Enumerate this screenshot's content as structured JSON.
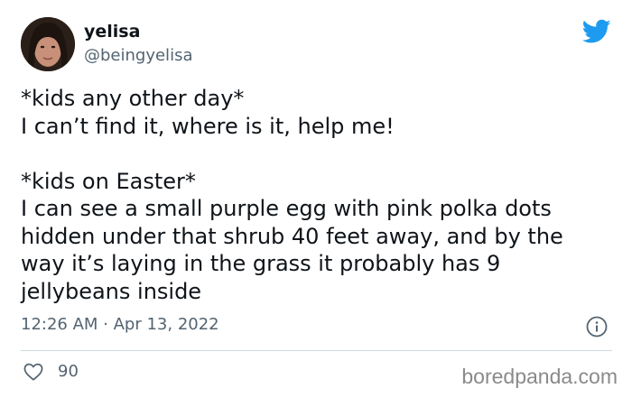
{
  "author": {
    "display_name": "yelisa",
    "handle": "@beingyelisa"
  },
  "tweet": {
    "lines_block1": [
      "*kids any other day*",
      "I can’t find it, where is it, help me!"
    ],
    "lines_block2": [
      "*kids on Easter*",
      "I can see a small purple egg with pink polka dots",
      "hidden under that shrub 40 feet away, and by the",
      "way it’s laying in the grass it probably has 9",
      "jellybeans inside"
    ],
    "timestamp": "12:26 AM · Apr 13, 2022",
    "likes": "90"
  },
  "watermark": "boredpanda.com",
  "icons": {
    "brand": "twitter-bird-icon",
    "info": "info-icon",
    "like": "heart-icon"
  },
  "colors": {
    "twitter_blue": "#1d9bf0",
    "text": "#0f1419",
    "secondary": "#536471",
    "divider": "#cfd9de"
  }
}
